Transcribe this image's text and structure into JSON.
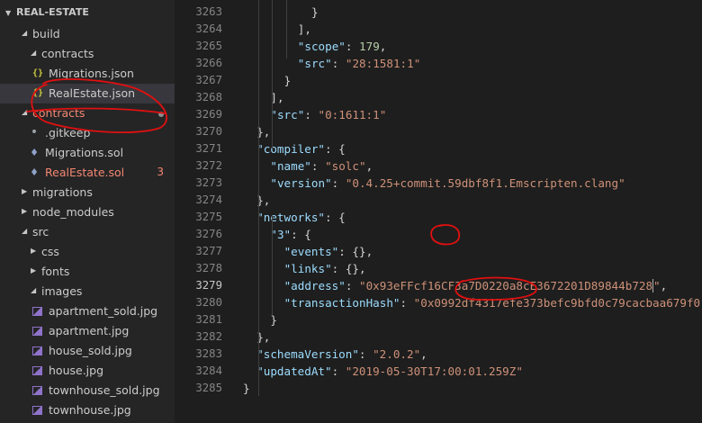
{
  "explorer": {
    "section_title": "REAL-ESTATE",
    "items": [
      {
        "label": "build",
        "kind": "folder-open"
      },
      {
        "label": "contracts",
        "kind": "folder-open"
      },
      {
        "label": "Migrations.json",
        "kind": "json"
      },
      {
        "label": "RealEstate.json",
        "kind": "json"
      },
      {
        "label": "contracts",
        "kind": "folder-open"
      },
      {
        "label": ".gitkeep",
        "kind": "file"
      },
      {
        "label": "Migrations.sol",
        "kind": "sol"
      },
      {
        "label": "RealEstate.sol",
        "kind": "sol",
        "badge": "3"
      },
      {
        "label": "migrations",
        "kind": "folder-closed"
      },
      {
        "label": "node_modules",
        "kind": "folder-closed"
      },
      {
        "label": "src",
        "kind": "folder-open"
      },
      {
        "label": "css",
        "kind": "folder-closed"
      },
      {
        "label": "fonts",
        "kind": "folder-closed"
      },
      {
        "label": "images",
        "kind": "folder-open"
      },
      {
        "label": "apartment_sold.jpg",
        "kind": "image"
      },
      {
        "label": "apartment.jpg",
        "kind": "image"
      },
      {
        "label": "house_sold.jpg",
        "kind": "image"
      },
      {
        "label": "house.jpg",
        "kind": "image"
      },
      {
        "label": "townhouse_sold.jpg",
        "kind": "image"
      },
      {
        "label": "townhouse.jpg",
        "kind": "image"
      }
    ]
  },
  "editor": {
    "active_line": "3279",
    "lines": [
      {
        "n": "3263",
        "t": [
          [
            "p",
            "}"
          ]
        ]
      },
      {
        "n": "3264",
        "t": [
          [
            "p",
            "],"
          ]
        ]
      },
      {
        "n": "3265",
        "t": [
          [
            "k",
            "\"scope\""
          ],
          [
            "p",
            ": "
          ],
          [
            "n",
            "179"
          ],
          [
            "p",
            ","
          ]
        ]
      },
      {
        "n": "3266",
        "t": [
          [
            "k",
            "\"src\""
          ],
          [
            "p",
            ": "
          ],
          [
            "s",
            "\"28:1581:1\""
          ]
        ]
      },
      {
        "n": "3267",
        "t": [
          [
            "p",
            "}"
          ]
        ]
      },
      {
        "n": "3268",
        "t": [
          [
            "p",
            "],"
          ]
        ]
      },
      {
        "n": "3269",
        "t": [
          [
            "k",
            "\"src\""
          ],
          [
            "p",
            ": "
          ],
          [
            "s",
            "\"0:1611:1\""
          ]
        ]
      },
      {
        "n": "3270",
        "t": [
          [
            "p",
            "},"
          ]
        ]
      },
      {
        "n": "3271",
        "t": [
          [
            "k",
            "\"compiler\""
          ],
          [
            "p",
            ": {"
          ]
        ]
      },
      {
        "n": "3272",
        "t": [
          [
            "k",
            "\"name\""
          ],
          [
            "p",
            ": "
          ],
          [
            "s",
            "\"solc\""
          ],
          [
            "p",
            ","
          ]
        ]
      },
      {
        "n": "3273",
        "t": [
          [
            "k",
            "\"version\""
          ],
          [
            "p",
            ": "
          ],
          [
            "s",
            "\"0.4.25+commit.59dbf8f1.Emscripten.clang\""
          ]
        ]
      },
      {
        "n": "3274",
        "t": [
          [
            "p",
            "},"
          ]
        ]
      },
      {
        "n": "3275",
        "t": [
          [
            "k",
            "\"networks\""
          ],
          [
            "p",
            ": {"
          ]
        ]
      },
      {
        "n": "3276",
        "t": [
          [
            "k",
            "\"3\""
          ],
          [
            "p",
            ": {"
          ]
        ]
      },
      {
        "n": "3277",
        "t": [
          [
            "k",
            "\"events\""
          ],
          [
            "p",
            ": {},"
          ]
        ]
      },
      {
        "n": "3278",
        "t": [
          [
            "k",
            "\"links\""
          ],
          [
            "p",
            ": {},"
          ]
        ]
      },
      {
        "n": "3279",
        "t": [
          [
            "k",
            "\"address\""
          ],
          [
            "p",
            ": "
          ],
          [
            "s",
            "\"0x93eFFcf16CF3a7D0220a8cE3672201D89844b728"
          ],
          [
            "cursor",
            ""
          ],
          [
            "s",
            "\""
          ],
          [
            "p",
            ","
          ]
        ]
      },
      {
        "n": "3280",
        "t": [
          [
            "k",
            "\"transactionHash\""
          ],
          [
            "p",
            ": "
          ],
          [
            "s",
            "\"0x0992df4317efe373befc9bfd0c79cacbaa679f0"
          ]
        ]
      },
      {
        "n": "3281",
        "t": [
          [
            "p",
            "}"
          ]
        ]
      },
      {
        "n": "3282",
        "t": [
          [
            "p",
            "},"
          ]
        ]
      },
      {
        "n": "3283",
        "t": [
          [
            "k",
            "\"schemaVersion\""
          ],
          [
            "p",
            ": "
          ],
          [
            "s",
            "\"2.0.2\""
          ],
          [
            "p",
            ","
          ]
        ]
      },
      {
        "n": "3284",
        "t": [
          [
            "k",
            "\"updatedAt\""
          ],
          [
            "p",
            ": "
          ],
          [
            "s",
            "\"2019-05-30T17:00:01.259Z\""
          ]
        ]
      },
      {
        "n": "3285",
        "t": [
          [
            "p",
            "}"
          ]
        ]
      }
    ]
  },
  "colors": {
    "sidebar_bg": "#252526",
    "editor_bg": "#1e1e1e",
    "json_key": "#9cdcfe",
    "json_string": "#ce9178",
    "json_number": "#b5cea8",
    "error_text": "#f48771",
    "annotation": "#e01010"
  }
}
